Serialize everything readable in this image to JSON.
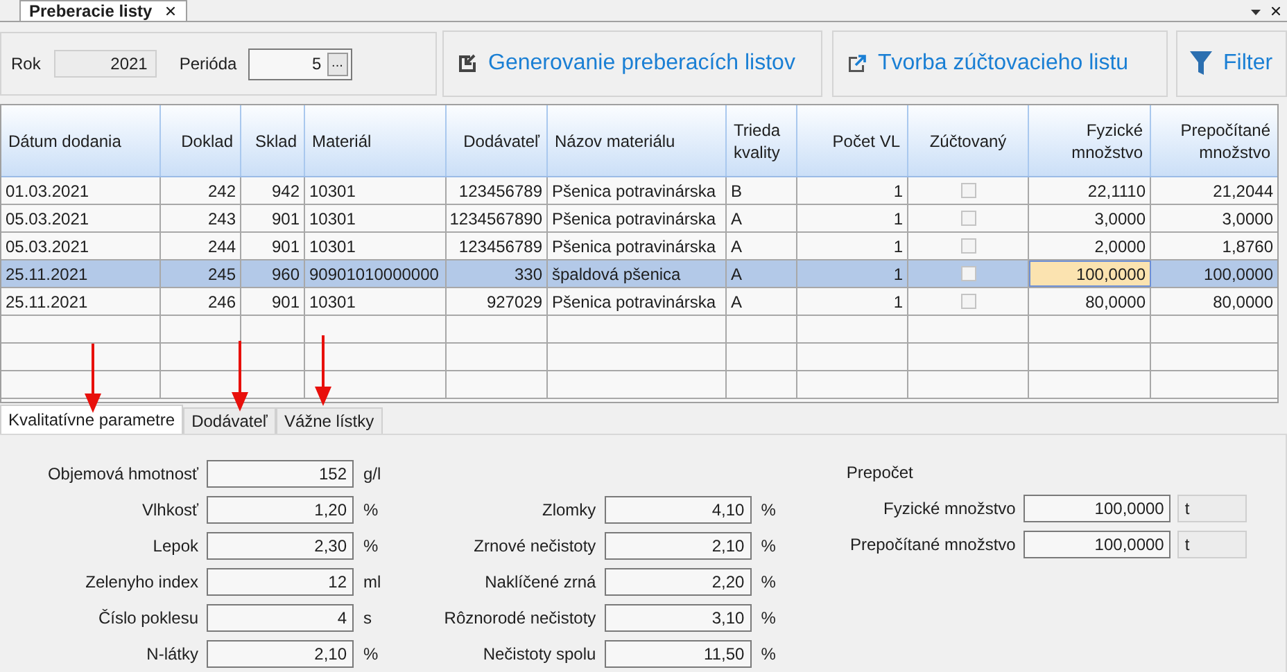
{
  "document_tab": {
    "title": "Preberacie listy",
    "selected": true
  },
  "toolbar": {
    "year": {
      "label": "Rok",
      "value": "2021"
    },
    "period": {
      "label": "Perióda",
      "value": "5",
      "browse": "..."
    },
    "buttons": [
      {
        "kind": "generate",
        "label": "Generovanie preberacích listov"
      },
      {
        "kind": "export",
        "label": "Tvorba zúčtovacieho listu"
      },
      {
        "kind": "filter",
        "label": "Filter"
      }
    ]
  },
  "table": {
    "columns": [
      "Dátum dodania",
      "Doklad",
      "Sklad",
      "Materiál",
      "Dodávateľ",
      "Názov materiálu",
      "Trieda kvality",
      "Počet VL",
      "Zúčtovaný",
      "Fyzické množstvo",
      "Prepočítané množstvo"
    ],
    "rows": [
      {
        "cells": [
          "01.03.2021",
          "242",
          "942",
          "10301",
          "123456789",
          "Pšenica potravinárska",
          "B",
          "1",
          "",
          "22,1110",
          "21,2044"
        ],
        "checked": false,
        "selected": false,
        "focused": false
      },
      {
        "cells": [
          "05.03.2021",
          "243",
          "901",
          "10301",
          "1234567890",
          "Pšenica potravinárska",
          "A",
          "1",
          "",
          "3,0000",
          "3,0000"
        ],
        "checked": false,
        "selected": false,
        "focused": false
      },
      {
        "cells": [
          "05.03.2021",
          "244",
          "901",
          "10301",
          "123456789",
          "Pšenica potravinárska",
          "A",
          "1",
          "",
          "2,0000",
          "1,8760"
        ],
        "checked": false,
        "selected": false,
        "focused": false
      },
      {
        "cells": [
          "25.11.2021",
          "245",
          "960",
          "90901010000000",
          "330",
          "špaldová pšenica",
          "A",
          "1",
          "",
          "100,0000",
          "100,0000"
        ],
        "checked": false,
        "selected": true,
        "focused": true
      },
      {
        "cells": [
          "25.11.2021",
          "246",
          "901",
          "10301",
          "927029",
          "Pšenica potravinárska",
          "A",
          "1",
          "",
          "80,0000",
          "80,0000"
        ],
        "checked": false,
        "selected": false,
        "focused": false
      }
    ]
  },
  "detail_tabs": [
    {
      "label": "Kvalitatívne parametre",
      "selected": true
    },
    {
      "label": "Dodávateľ",
      "selected": false
    },
    {
      "label": "Vážne lístky",
      "selected": false
    }
  ],
  "quality_parameters": {
    "column_1": [
      {
        "label": "Objemová hmotnosť",
        "value": "152",
        "unit": "g/l"
      },
      {
        "label": "Vlhkosť",
        "value": "1,20",
        "unit": "%"
      },
      {
        "label": "Lepok",
        "value": "2,30",
        "unit": "%"
      },
      {
        "label": "Zelenyho index",
        "value": "12",
        "unit": "ml"
      },
      {
        "label": "Číslo poklesu",
        "value": "4",
        "unit": "s"
      },
      {
        "label": "N-látky",
        "value": "2,10",
        "unit": "%"
      }
    ],
    "column_2": [
      {
        "label": "Zlomky",
        "value": "4,10",
        "unit": "%"
      },
      {
        "label": "Zrnové nečistoty",
        "value": "2,10",
        "unit": "%"
      },
      {
        "label": "Naklíčené zrná",
        "value": "2,20",
        "unit": "%"
      },
      {
        "label": "Rôznorodé nečistoty",
        "value": "3,10",
        "unit": "%"
      },
      {
        "label": "Nečistoty spolu",
        "value": "11,50",
        "unit": "%"
      }
    ],
    "conversion": {
      "title": "Prepočet",
      "fields": [
        {
          "label": "Fyzické množstvo",
          "value": "100,0000",
          "unit": "t"
        },
        {
          "label": "Prepočítané množstvo",
          "value": "100,0000",
          "unit": "t"
        }
      ]
    }
  }
}
